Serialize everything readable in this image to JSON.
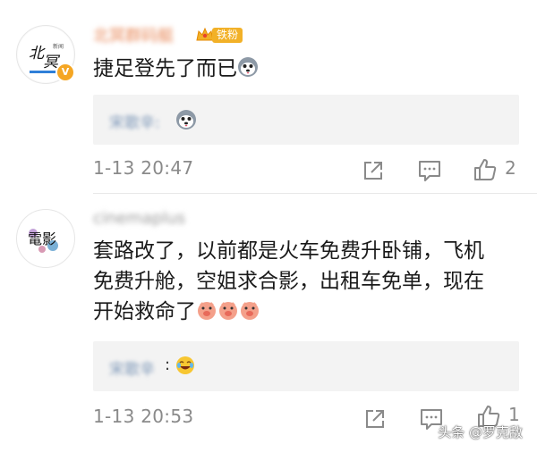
{
  "comments": [
    {
      "username": "北冥群码艇",
      "fan_badge": "铁粉",
      "text": "捷足登先了而已",
      "reply_name": "宋歌辛:",
      "timestamp": "1-13 20:47",
      "likes": "2",
      "text_emoji": "husky-emoji",
      "reply_emoji": "husky-emoji"
    },
    {
      "username": "cinemaplus",
      "text_line1": "套路改了，以前都是火车免费升卧铺，飞机",
      "text_line2": "免费升舱，空姐求合影，出租车免单，现在",
      "text_line3": "开始救命了",
      "reply_name": "宋歌辛",
      "reply_colon": ":",
      "timestamp": "1-13 20:53",
      "likes": "1",
      "text_emoji": "pig-emoji",
      "reply_emoji": "laugh-emoji"
    }
  ],
  "watermark": "头条 @罗克敌",
  "colors": {
    "accent": "#f2b128",
    "meta": "#8a8a8a",
    "reply_bg": "#f3f3f3"
  }
}
